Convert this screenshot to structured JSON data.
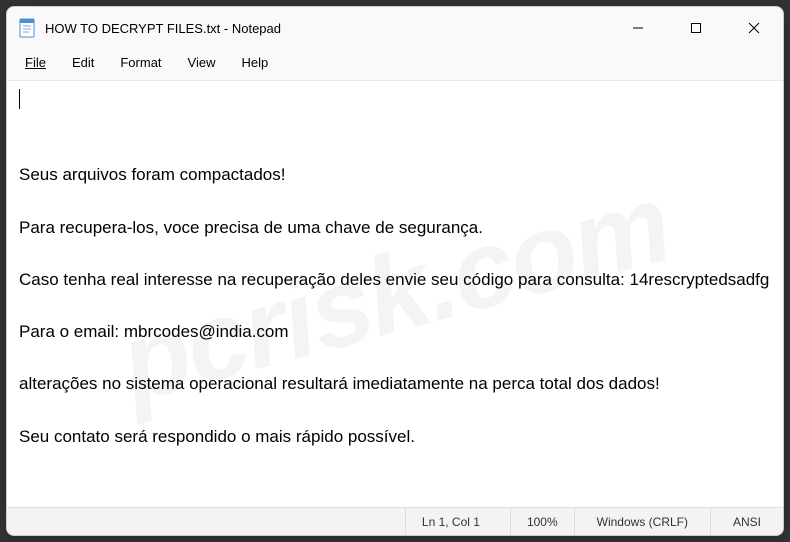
{
  "window": {
    "title": "HOW TO DECRYPT FILES.txt - Notepad"
  },
  "menu": {
    "file": "File",
    "edit": "Edit",
    "format": "Format",
    "view": "View",
    "help": "Help"
  },
  "content": "\nSeus arquivos foram compactados!\n\nPara recupera-los, voce precisa de uma chave de segurança.\n\nCaso tenha real interesse na recuperação deles envie seu código para consulta: 14rescryptedsadfg\n\nPara o email: mbrcodes@india.com\n\nalterações no sistema operacional resultará imediatamente na perca total dos dados!\n\nSeu contato será respondido o mais rápido possível.",
  "status": {
    "position": "Ln 1, Col 1",
    "zoom": "100%",
    "lineEnding": "Windows (CRLF)",
    "encoding": "ANSI"
  },
  "watermark": "pcrisk.com"
}
